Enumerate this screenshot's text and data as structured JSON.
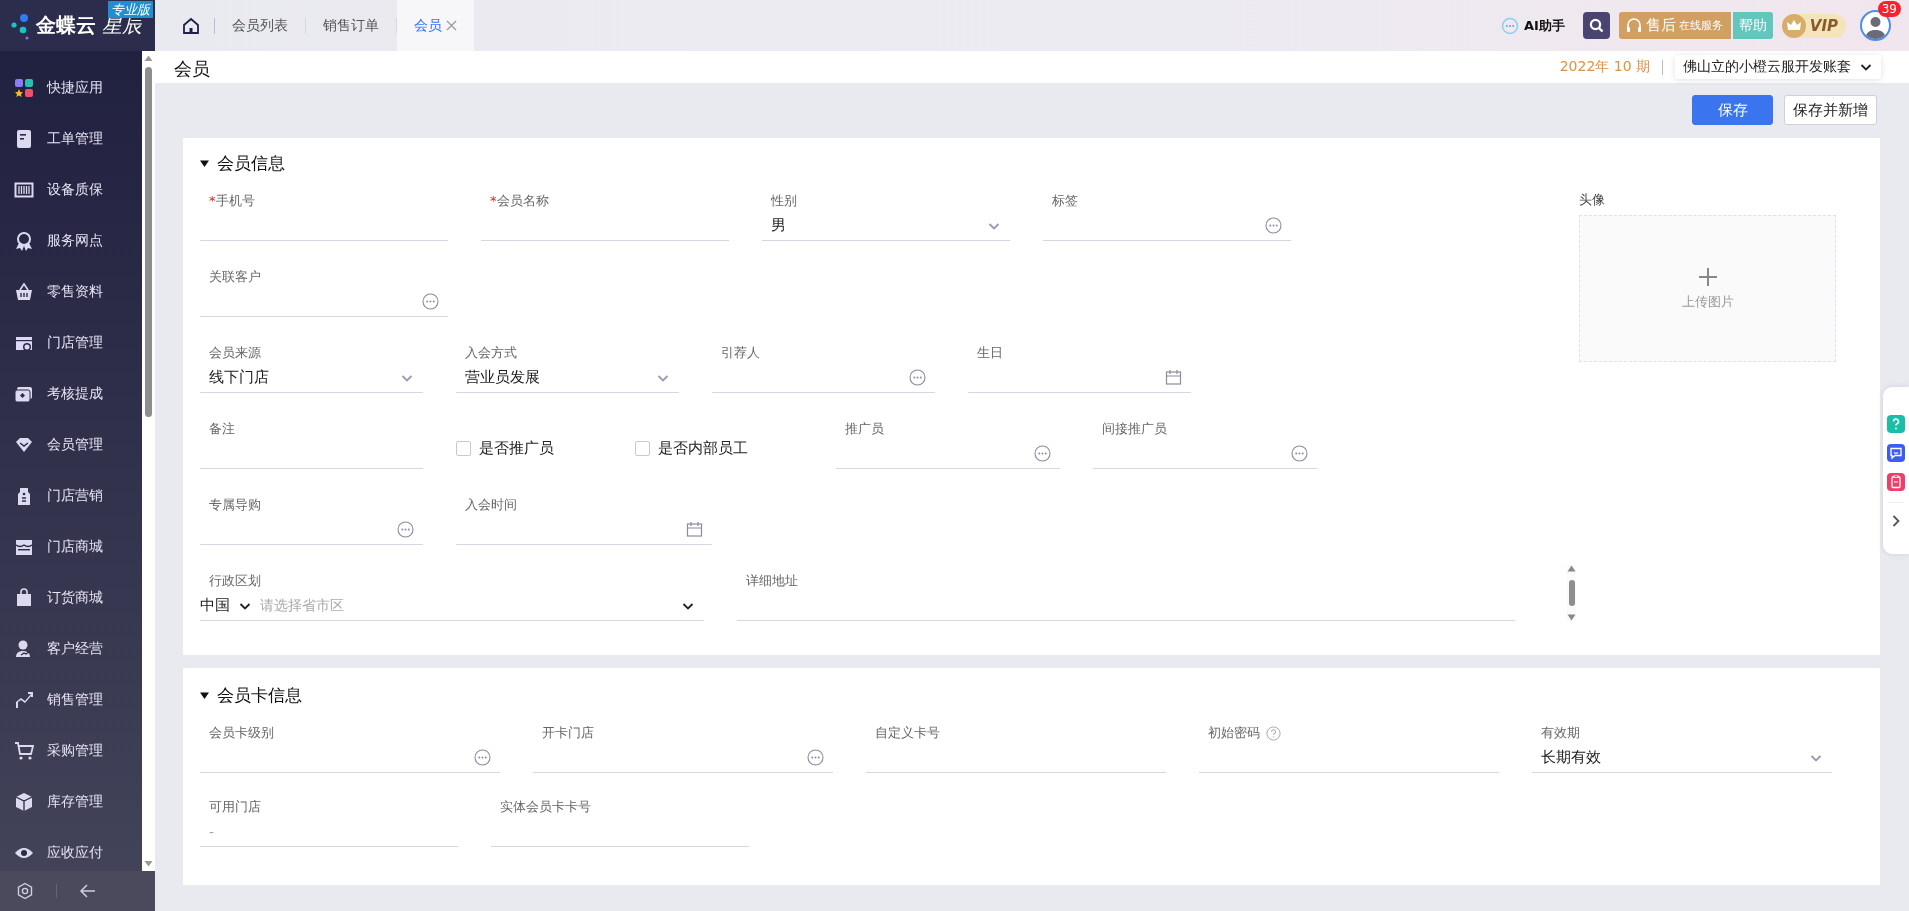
{
  "sidebar": {
    "brand": "金蝶云",
    "product": "星辰",
    "edition_badge": "专业版",
    "items": [
      {
        "label": "快捷应用"
      },
      {
        "label": "工单管理"
      },
      {
        "label": "设备质保"
      },
      {
        "label": "服务网点"
      },
      {
        "label": "零售资料"
      },
      {
        "label": "门店管理"
      },
      {
        "label": "考核提成"
      },
      {
        "label": "会员管理"
      },
      {
        "label": "门店营销"
      },
      {
        "label": "门店商城"
      },
      {
        "label": "订货商城"
      },
      {
        "label": "客户经营"
      },
      {
        "label": "销售管理"
      },
      {
        "label": "采购管理"
      },
      {
        "label": "库存管理"
      },
      {
        "label": "应收应付"
      }
    ]
  },
  "tabs": [
    {
      "label": "会员列表",
      "selected": false,
      "closable": false
    },
    {
      "label": "销售订单",
      "selected": false,
      "closable": false
    },
    {
      "label": "会员",
      "selected": true,
      "closable": true
    }
  ],
  "header": {
    "ai_assistant": "AI助手",
    "service_button": {
      "main": "售后",
      "sub": "在线服务"
    },
    "help_button": "帮助",
    "vip_badge": "VIP",
    "notification_count": "39"
  },
  "page": {
    "title": "会员",
    "period": "2022年 10 期",
    "account": "佛山立的小橙云服开发账套"
  },
  "actions": [
    {
      "label": "保存",
      "primary": true
    },
    {
      "label": "保存并新增",
      "primary": false
    }
  ],
  "sections": [
    {
      "title": "会员信息",
      "expanded": true,
      "avatar": {
        "label": "头像",
        "upload_text": "上传图片"
      },
      "rows": [
        [
          {
            "kind": "text",
            "label": "手机号",
            "required_mark": "*"
          },
          {
            "kind": "text",
            "label": "会员名称",
            "required_mark": "*"
          },
          {
            "kind": "select",
            "label": "性别",
            "value": "男"
          },
          {
            "kind": "lookup",
            "label": "标签"
          }
        ],
        [
          {
            "kind": "lookup",
            "label": "关联客户"
          }
        ],
        [
          {
            "kind": "select",
            "label": "会员来源",
            "value": "线下门店"
          },
          {
            "kind": "select",
            "label": "入会方式",
            "value": "营业员发展"
          },
          {
            "kind": "lookup",
            "label": "引荐人"
          },
          {
            "kind": "date",
            "label": "生日"
          }
        ],
        [
          {
            "kind": "text",
            "label": "备注"
          },
          {
            "kind": "checkbox",
            "label": "是否推广员",
            "checked": false
          },
          {
            "kind": "checkbox",
            "label": "是否内部员工",
            "checked": false
          },
          {
            "kind": "lookup",
            "label": "推广员"
          },
          {
            "kind": "lookup",
            "label": "间接推广员"
          }
        ],
        [
          {
            "kind": "lookup",
            "label": "专属导购"
          },
          {
            "kind": "date",
            "label": "入会时间"
          }
        ],
        [
          {
            "kind": "region",
            "label": "行政区划",
            "country": "中国",
            "placeholder": "请选择省市区"
          },
          {
            "kind": "text",
            "label": "详细地址"
          }
        ]
      ]
    },
    {
      "title": "会员卡信息",
      "expanded": true,
      "rows": [
        [
          {
            "kind": "lookup",
            "label": "会员卡级别"
          },
          {
            "kind": "lookup",
            "label": "开卡门店"
          },
          {
            "kind": "text",
            "label": "自定义卡号"
          },
          {
            "kind": "text",
            "label": "初始密码",
            "help": true
          },
          {
            "kind": "select",
            "label": "有效期",
            "value": "长期有效"
          }
        ],
        [
          {
            "kind": "text",
            "label": "可用门店",
            "placeholder": "-"
          },
          {
            "kind": "text",
            "label": "实体会员卡卡号"
          }
        ]
      ]
    }
  ]
}
